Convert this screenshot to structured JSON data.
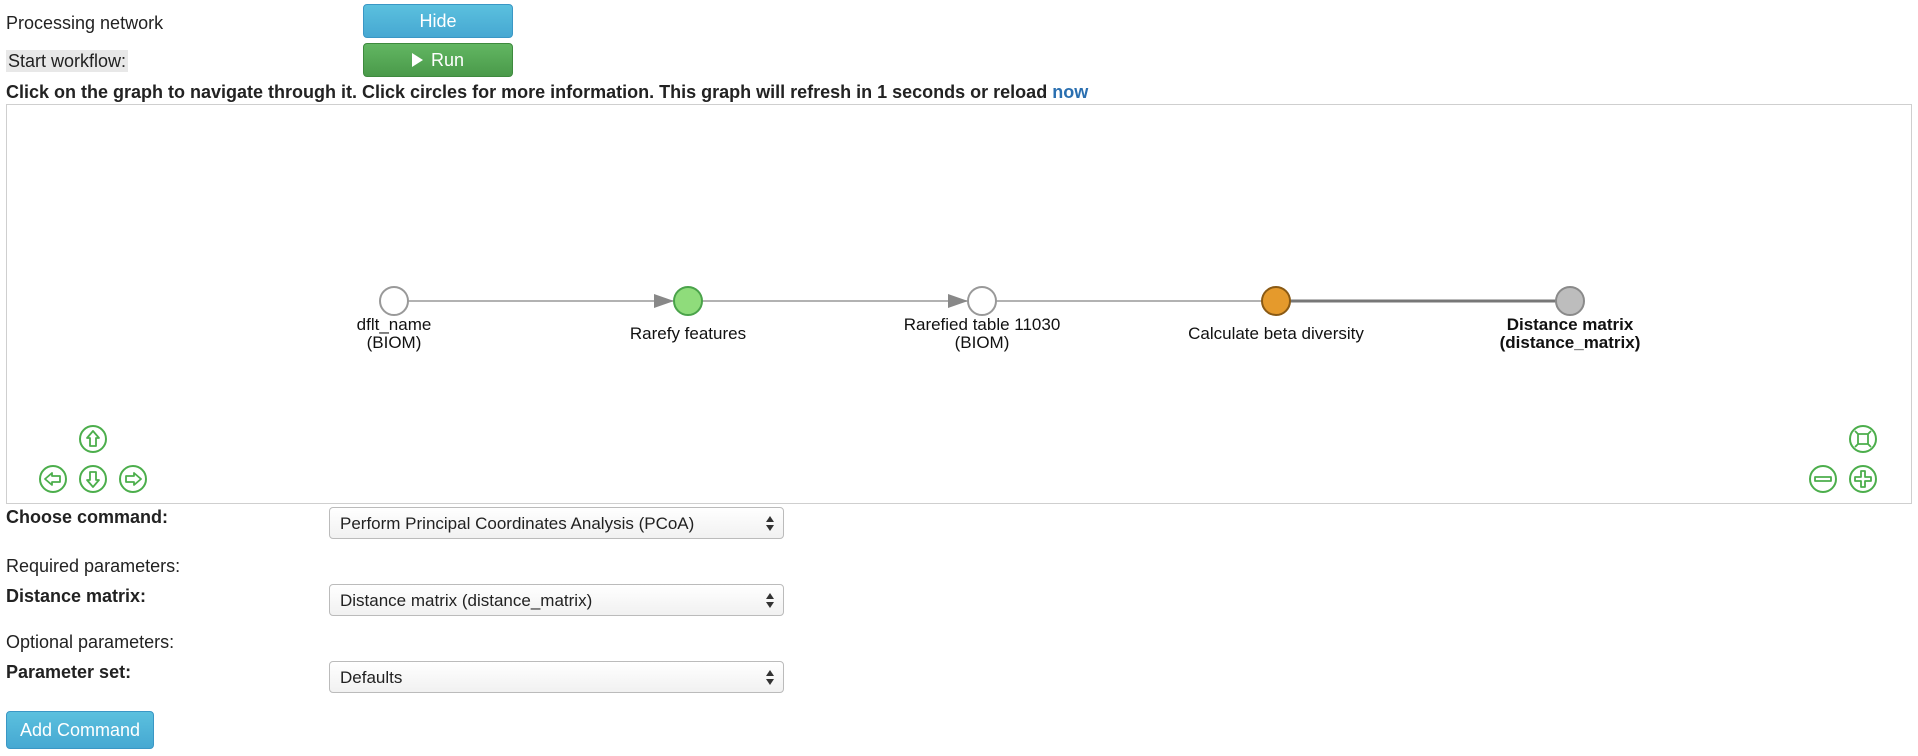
{
  "header": {
    "processing_label": "Processing network",
    "hide_label": "Hide",
    "start_label": "Start workflow:",
    "run_label": "Run"
  },
  "instructions": {
    "text": "Click on the graph to navigate through it. Click circles for more information. This graph will refresh in 1 seconds or reload ",
    "link": "now"
  },
  "graph": {
    "nodes": [
      {
        "line1": "dflt_name",
        "line2": "(BIOM)",
        "color": "#ffffff"
      },
      {
        "line1": "Rarefy features",
        "line2": "",
        "color": "#8fdc7b"
      },
      {
        "line1": "Rarefied table 11030",
        "line2": "(BIOM)",
        "color": "#ffffff"
      },
      {
        "line1": "Calculate beta diversity",
        "line2": "",
        "color": "#e59a2c"
      },
      {
        "line1": "Distance matrix",
        "line2": "(distance_matrix)",
        "color": "#bdbdbd"
      }
    ],
    "nav_icons": [
      "arrow-up-icon",
      "arrow-left-icon",
      "arrow-down-icon",
      "arrow-right-icon",
      "fit-icon",
      "zoom-out-icon",
      "zoom-in-icon"
    ],
    "nav_color": "#4cae4c"
  },
  "form": {
    "choose_label": "Choose command:",
    "choose_value": "Perform Principal Coordinates Analysis (PCoA)",
    "required_label": "Required parameters:",
    "distance_label": "Distance matrix:",
    "distance_value": "Distance matrix (distance_matrix)",
    "optional_label": "Optional parameters:",
    "paramset_label": "Parameter set:",
    "paramset_value": "Defaults",
    "add_label": "Add Command"
  }
}
